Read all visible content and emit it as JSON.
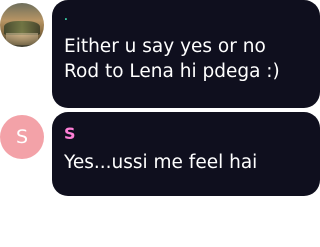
{
  "messages": [
    {
      "avatar": {
        "type": "photo"
      },
      "sender": ".",
      "sender_color": "#39c6a0",
      "lines": [
        "Either u say yes or no",
        "Rod to Lena hi pdega :)"
      ]
    },
    {
      "avatar": {
        "type": "initial",
        "initial": "S",
        "color": "#f3a2a8"
      },
      "sender": "S",
      "sender_color": "#ff7fd7",
      "lines": [
        "Yes...ussi me feel hai"
      ]
    }
  ],
  "colors": {
    "bubble": "#0f0f1e",
    "text": "#ffffff",
    "background": "#ffffff"
  }
}
